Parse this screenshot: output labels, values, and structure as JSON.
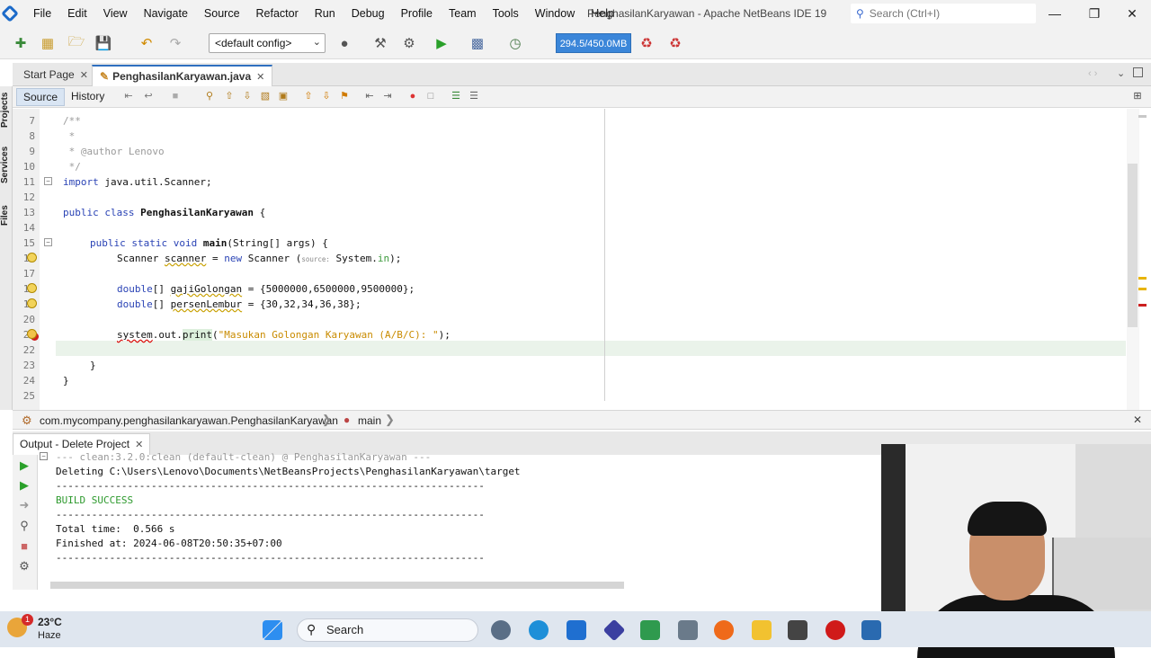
{
  "menubar": {
    "items": [
      "File",
      "Edit",
      "View",
      "Navigate",
      "Source",
      "Refactor",
      "Run",
      "Debug",
      "Profile",
      "Team",
      "Tools",
      "Window",
      "Help"
    ],
    "window_title": "PenghasilanKaryawan - Apache NetBeans IDE 19",
    "search_placeholder": "Search (Ctrl+I)"
  },
  "toolbar": {
    "config": "<default config>",
    "memory": "294.5/450.0MB"
  },
  "left_tabs": [
    "Projects",
    "Services",
    "Files"
  ],
  "editor_tabs": {
    "start": "Start Page",
    "active": "PenghasilanKaryawan.java"
  },
  "source_bar": {
    "source": "Source",
    "history": "History"
  },
  "code": {
    "line_numbers": [
      "7",
      "8",
      "9",
      "10",
      "11",
      "12",
      "13",
      "14",
      "15",
      "16",
      "17",
      "18",
      "19",
      "20",
      "21",
      "22",
      "23",
      "24",
      "25"
    ],
    "l7": "/**",
    "l8": " *",
    "l9": " * @author Lenovo",
    "l10": " */",
    "l11a": "import",
    "l11b": " java.util.Scanner;",
    "l13a": "public class",
    "l13b": "PenghasilanKaryawan",
    "l13c": " {",
    "l15a": "public static void",
    "l15b": "main",
    "l15c": "(String[] args) {",
    "l16a": "Scanner ",
    "l16b": "scanner",
    "l16c": " = ",
    "l16d": "new",
    "l16e": " Scanner (",
    "l16f": "source:",
    "l16g": " System.",
    "l16h": "in",
    "l16i": ");",
    "l18a": "double",
    "l18b": "[] ",
    "l18c": "gajiGolongan",
    "l18d": " = {5000000,6500000,9500000};",
    "l19a": "double",
    "l19b": "[] ",
    "l19c": "persenLembur",
    "l19d": " = {30,32,34,36,38};",
    "l21a": "system",
    "l21b": ".out.",
    "l21c": "print",
    "l21d": "(",
    "l21e": "\"Masukan Golongan Karyawan (A/B/C): \"",
    "l21f": ");",
    "l23": "}",
    "l24": "}"
  },
  "breadcrumb": {
    "class_path": "com.mycompany.penghasilankaryawan.PenghasilanKaryawan",
    "method": "main"
  },
  "output": {
    "tab_label": "Output - Delete Project",
    "lines": [
      "--- clean:3.2.0:clean (default-clean) @ PenghasilanKaryawan ---",
      "Deleting C:\\Users\\Lenovo\\Documents\\NetBeansProjects\\PenghasilanKaryawan\\target",
      "------------------------------------------------------------------------",
      "BUILD SUCCESS",
      "------------------------------------------------------------------------",
      "Total time:  0.566 s",
      "Finished at: 2024-06-08T20:50:35+07:00",
      "------------------------------------------------------------------------"
    ]
  },
  "taskbar": {
    "temperature": "23°C",
    "weather": "Haze",
    "badge": "1",
    "search_label": "Search"
  },
  "colors": {
    "memory_bar": "#3b86d9",
    "build_success": "#2e9a2e",
    "keyword": "#2a43b5",
    "string": "#c98b00"
  }
}
